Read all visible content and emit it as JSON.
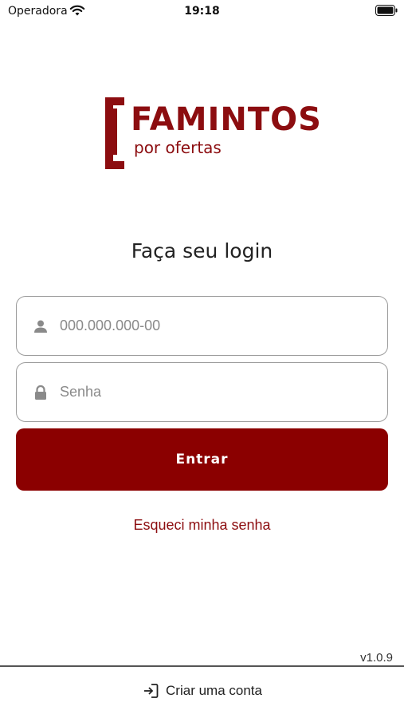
{
  "status_bar": {
    "carrier": "Operadora",
    "time": "19:18",
    "icons": [
      "wifi-icon",
      "battery-icon"
    ]
  },
  "logo": {
    "title": "FAMINTOS",
    "subtitle": "por ofertas",
    "color": "#8c0d10"
  },
  "login": {
    "title": "Faça seu login",
    "cpf_placeholder": "000.000.000-00",
    "cpf_value": "",
    "password_placeholder": "Senha",
    "password_value": "",
    "enter_label": "Entrar",
    "forgot_label": "Esqueci minha senha"
  },
  "footer": {
    "version": "v1.0.9",
    "create_account_label": "Criar uma conta"
  },
  "colors": {
    "primary": "#8b0000",
    "link": "#8c0d10",
    "border": "#9c9c9c",
    "icon_gray": "#8a8a8a"
  }
}
